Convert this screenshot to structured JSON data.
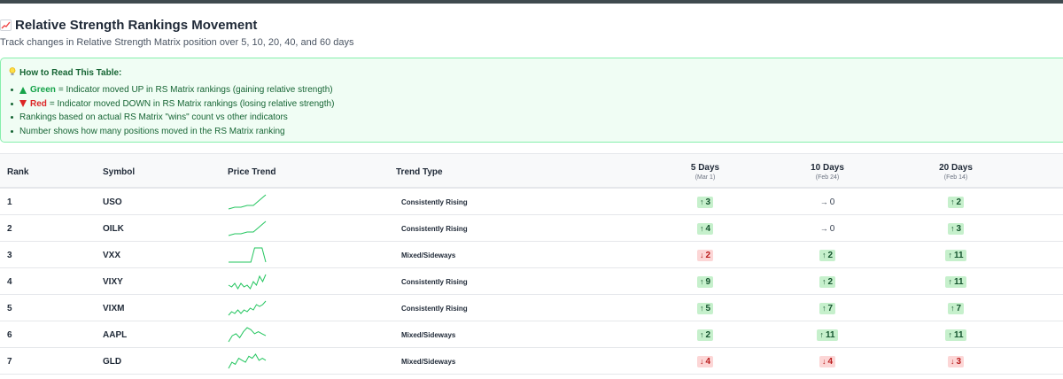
{
  "header": {
    "title": "Relative Strength Rankings Movement",
    "title_icon": "chart-increasing-icon",
    "subtitle": "Track changes in Relative Strength Matrix position over 5, 10, 20, 40, and 60 days"
  },
  "info": {
    "title": "How to Read This Table:",
    "green_word": "Green",
    "green_text": "= Indicator moved UP in RS Matrix rankings (gaining relative strength)",
    "red_word": "Red",
    "red_text": "= Indicator moved DOWN in RS Matrix rankings (losing relative strength)",
    "line3": "Rankings based on actual RS Matrix \"wins\" count vs other indicators",
    "line4": "Number shows how many positions moved in the RS Matrix ranking"
  },
  "table": {
    "columns": {
      "rank": "Rank",
      "symbol": "Symbol",
      "price_trend": "Price Trend",
      "trend_type": "Trend Type",
      "d5": "5 Days",
      "d5_date": "(Mar 1)",
      "d10": "10 Days",
      "d10_date": "(Feb 24)",
      "d20": "20 Days",
      "d20_date": "(Feb 14)"
    },
    "rows": [
      {
        "rank": "1",
        "symbol": "USO",
        "trend_type": "Consistently Rising",
        "spark": [
          2,
          3,
          3,
          4,
          4,
          7,
          10
        ],
        "d5": {
          "dir": "up",
          "val": "3"
        },
        "d10": {
          "dir": "flat",
          "val": "0"
        },
        "d20": {
          "dir": "up",
          "val": "2"
        }
      },
      {
        "rank": "2",
        "symbol": "OILK",
        "trend_type": "Consistently Rising",
        "spark": [
          2,
          3,
          3,
          4,
          4,
          7,
          10
        ],
        "d5": {
          "dir": "up",
          "val": "4"
        },
        "d10": {
          "dir": "flat",
          "val": "0"
        },
        "d20": {
          "dir": "up",
          "val": "3"
        }
      },
      {
        "rank": "3",
        "symbol": "VXX",
        "trend_type": "Mixed/Sideways",
        "spark": [
          1,
          1,
          1,
          1,
          1,
          1,
          1,
          10,
          10,
          10,
          1
        ],
        "d5": {
          "dir": "down",
          "val": "2"
        },
        "d10": {
          "dir": "up",
          "val": "2"
        },
        "d20": {
          "dir": "up",
          "val": "11"
        }
      },
      {
        "rank": "4",
        "symbol": "VIXY",
        "trend_type": "Consistently Rising",
        "spark": [
          4,
          3,
          5,
          2,
          5,
          3,
          4,
          2,
          6,
          4,
          9,
          6,
          10
        ],
        "d5": {
          "dir": "up",
          "val": "9"
        },
        "d10": {
          "dir": "up",
          "val": "2"
        },
        "d20": {
          "dir": "up",
          "val": "11"
        }
      },
      {
        "rank": "5",
        "symbol": "VIXM",
        "trend_type": "Consistently Rising",
        "spark": [
          2,
          4,
          3,
          5,
          3,
          5,
          4,
          6,
          5,
          8,
          7,
          8,
          10
        ],
        "d5": {
          "dir": "up",
          "val": "5"
        },
        "d10": {
          "dir": "up",
          "val": "7"
        },
        "d20": {
          "dir": "up",
          "val": "7"
        }
      },
      {
        "rank": "6",
        "symbol": "AAPL",
        "trend_type": "Mixed/Sideways",
        "spark": [
          2,
          5,
          6,
          4,
          7,
          9,
          8,
          6,
          7,
          6,
          5
        ],
        "d5": {
          "dir": "up",
          "val": "2"
        },
        "d10": {
          "dir": "up",
          "val": "11"
        },
        "d20": {
          "dir": "up",
          "val": "11"
        }
      },
      {
        "rank": "7",
        "symbol": "GLD",
        "trend_type": "Mixed/Sideways",
        "spark": [
          2,
          5,
          4,
          7,
          6,
          5,
          8,
          7,
          9,
          6,
          7,
          6
        ],
        "d5": {
          "dir": "down",
          "val": "4"
        },
        "d10": {
          "dir": "down",
          "val": "4"
        },
        "d20": {
          "dir": "down",
          "val": "3"
        }
      }
    ]
  },
  "colors": {
    "up_bg": "#c6f0cc",
    "down_bg": "#fcd6d6",
    "spark_line": "#22c55e",
    "info_bg": "#f0fdf4",
    "info_border": "#86efac"
  }
}
